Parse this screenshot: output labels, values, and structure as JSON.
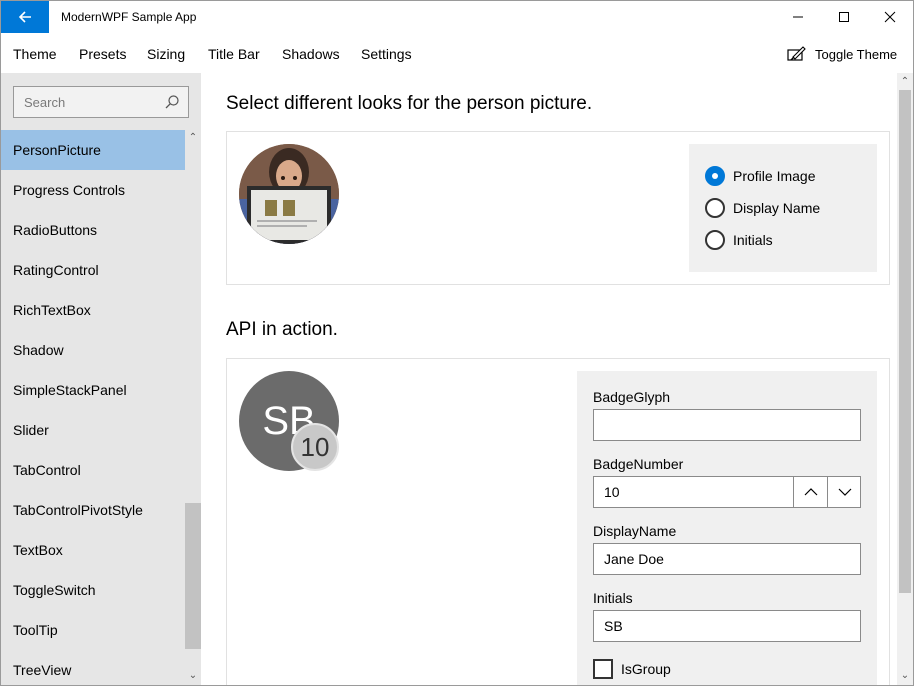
{
  "window": {
    "title": "ModernWPF Sample App"
  },
  "menu": {
    "items": [
      "Theme",
      "Presets",
      "Sizing",
      "Title Bar",
      "Shadows",
      "Settings"
    ],
    "toggle_theme": "Toggle Theme"
  },
  "sidebar": {
    "search_placeholder": "Search",
    "items": [
      "PersonPicture",
      "Progress Controls",
      "RadioButtons",
      "RatingControl",
      "RichTextBox",
      "Shadow",
      "SimpleStackPanel",
      "Slider",
      "TabControl",
      "TabControlPivotStyle",
      "TextBox",
      "ToggleSwitch",
      "ToolTip",
      "TreeView"
    ],
    "selected": "PersonPicture"
  },
  "section1": {
    "heading": "Select different looks for the person picture.",
    "options": [
      "Profile Image",
      "Display Name",
      "Initials"
    ],
    "selected": "Profile Image"
  },
  "section2": {
    "heading": "API in action.",
    "avatar_initials": "SB",
    "badge_number": "10",
    "fields": {
      "badge_glyph_label": "BadgeGlyph",
      "badge_glyph_value": "",
      "badge_number_label": "BadgeNumber",
      "badge_number_value": "10",
      "display_name_label": "DisplayName",
      "display_name_value": "Jane Doe",
      "initials_label": "Initials",
      "initials_value": "SB",
      "is_group_label": "IsGroup",
      "is_group_checked": false
    }
  },
  "colors": {
    "accent": "#0078d7",
    "selection": "#99c1e6",
    "sidebar_bg": "#e6e6e6"
  }
}
